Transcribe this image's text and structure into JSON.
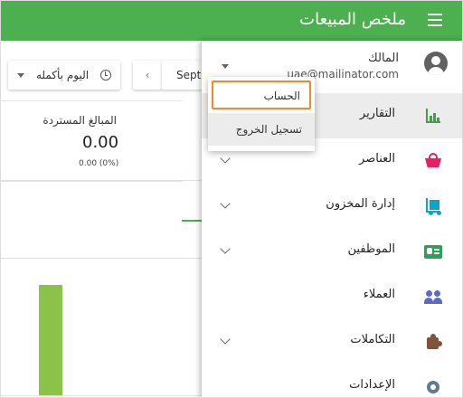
{
  "header": {
    "title": "ملخص المبيعات",
    "menu_icon": "hamburger-icon"
  },
  "toolbar": {
    "day_range_label": "اليوم بأكمله",
    "date_label": "Sept",
    "prev_symbol": "‹"
  },
  "summary": {
    "refunds_label": "المبالغ المستردة",
    "refunds_value": "0.00",
    "refunds_sub": "0.00 (0%)"
  },
  "chart_data": {
    "type": "bar",
    "series": [
      {
        "values": [
          1
        ]
      }
    ]
  },
  "account": {
    "name": "المالك",
    "email": "uae@mailinator.com"
  },
  "account_menu": {
    "account": "الحساب",
    "logout": "تسجيل الخروج"
  },
  "nav": {
    "items": [
      {
        "label": "التقارير",
        "icon": "bar-chart-icon",
        "active": true
      },
      {
        "label": "العناصر",
        "icon": "basket-icon"
      },
      {
        "label": "إدارة المخزون",
        "icon": "inventory-cart-icon"
      },
      {
        "label": "الموظفين",
        "icon": "id-card-icon"
      },
      {
        "label": "العملاء",
        "icon": "people-icon"
      },
      {
        "label": "التكاملات",
        "icon": "puzzle-icon"
      },
      {
        "label": "الإعدادات",
        "icon": "gear-icon"
      }
    ]
  },
  "colors": {
    "header": "#4caf50",
    "popup_highlight": "#ef8a2d",
    "bar": "#8bc34a"
  }
}
